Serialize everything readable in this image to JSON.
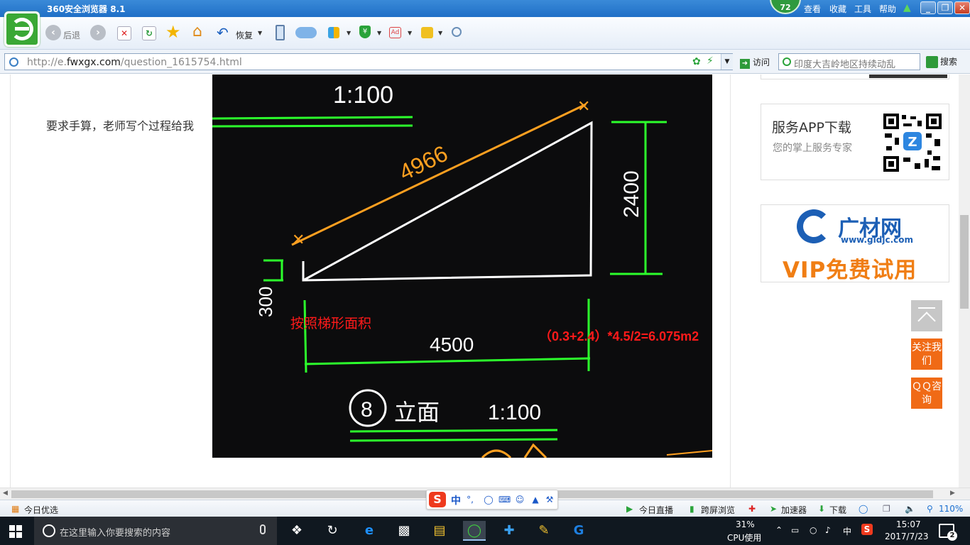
{
  "window": {
    "title": "360安全浏览器 8.1",
    "score": "72",
    "menus": [
      "查看",
      "收藏",
      "工具",
      "帮助"
    ]
  },
  "toolbar": {
    "back_label": "后退",
    "restore_label": "恢复"
  },
  "address": {
    "url_prefix": "http://e.",
    "url_domain": "fwxgx.com",
    "url_path": "/question_1615754.html",
    "visit_label": "访问",
    "search_query": "印度大吉岭地区持续动乱",
    "search_button": "搜索"
  },
  "content": {
    "question_text": "要求手算，老师写个过程给我",
    "drawing": {
      "scale_top": "1:100",
      "slope_length": "4966",
      "height_right": "2400",
      "height_left": "300",
      "width_bottom": "4500",
      "view_number": "8",
      "view_name": "立面",
      "view_scale": "1:100",
      "annotation_method": "按照梯形面积",
      "annotation_formula": "（0.3+2.4）*4.5/2=6.075m2",
      "annotation_color": "#ff1a1a",
      "dimension_color": "#1cff1c",
      "slope_dim_color": "#ffa020"
    }
  },
  "sidebar": {
    "app_card": {
      "title": "服务APP下载",
      "subtitle": "您的掌上服务专家"
    },
    "ad": {
      "brand": "广材网",
      "url": "www.gldjc.com",
      "slogan": "VIP免费试用"
    },
    "follow_label": "关注我们",
    "qq_label": "ＱＱ咨询"
  },
  "statusbar": {
    "left": "今日优选",
    "items": [
      "今日直播",
      "跨屏浏览",
      "加速器",
      "下载"
    ],
    "zoom": "110%"
  },
  "ime": {
    "mode": "中"
  },
  "taskbar": {
    "search_placeholder": "在这里输入你要搜索的内容",
    "cpu_percent": "31%",
    "cpu_label": "CPU使用",
    "ime_indicator": "中",
    "time": "15:07",
    "date": "2017/7/23",
    "notifications": "2"
  }
}
